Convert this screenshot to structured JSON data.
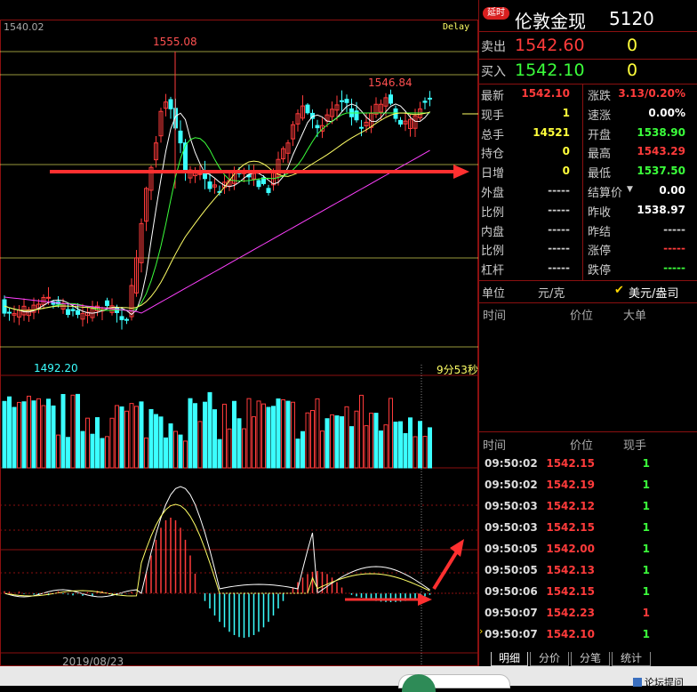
{
  "chart": {
    "price_top_left": "1540.02",
    "delay_label": "Delay",
    "high_label": "1555.08",
    "mid_high_label": "1546.84",
    "low_label": "1492.20",
    "countdown": "9分53秒",
    "date_label": "2019/08/23"
  },
  "header": {
    "badge": "延时",
    "title": "伦敦金现",
    "code": "5120"
  },
  "quote": {
    "sell_label": "卖出",
    "sell_price": "1542.60",
    "sell_qty": "0",
    "buy_label": "买入",
    "buy_price": "1542.10",
    "buy_qty": "0"
  },
  "stats": {
    "left": [
      {
        "label": "最新",
        "value": "1542.10",
        "color": "#ff3b3b"
      },
      {
        "label": "现手",
        "value": "1",
        "color": "#ffff3b"
      },
      {
        "label": "总手",
        "value": "14521",
        "color": "#ffff3b"
      },
      {
        "label": "持仓",
        "value": "0",
        "color": "#ffff3b"
      },
      {
        "label": "日增",
        "value": "0",
        "color": "#ffff3b"
      },
      {
        "label": "外盘",
        "value": "-----",
        "color": "#cccccc"
      },
      {
        "label": "比例",
        "value": "-----",
        "color": "#cccccc"
      },
      {
        "label": "内盘",
        "value": "-----",
        "color": "#cccccc"
      },
      {
        "label": "比例",
        "value": "-----",
        "color": "#cccccc"
      },
      {
        "label": "杠杆",
        "value": "-----",
        "color": "#cccccc"
      }
    ],
    "right": [
      {
        "label": "涨跌",
        "value": "3.13/0.20%",
        "color": "#ff3b3b"
      },
      {
        "label": "速涨",
        "value": "0.00%",
        "color": "#ffffff"
      },
      {
        "label": "开盘",
        "value": "1538.90",
        "color": "#3bff3b"
      },
      {
        "label": "最高",
        "value": "1543.29",
        "color": "#ff3b3b"
      },
      {
        "label": "最低",
        "value": "1537.50",
        "color": "#3bff3b"
      },
      {
        "label": "结算价",
        "value": "0.00",
        "color": "#ffffff"
      },
      {
        "label": "昨收",
        "value": "1538.97",
        "color": "#ffffff"
      },
      {
        "label": "昨结",
        "value": "-----",
        "color": "#cccccc"
      },
      {
        "label": "涨停",
        "value": "-----",
        "color": "#ff3b3b"
      },
      {
        "label": "跌停",
        "value": "-----",
        "color": "#3bff3b"
      }
    ]
  },
  "unit": {
    "label": "单位",
    "option_a": "元/克",
    "check": "✔",
    "option_b": "美元/盎司"
  },
  "bigorders": {
    "col_time": "时间",
    "col_price": "价位",
    "col_big": "大单"
  },
  "ticks": {
    "col_time": "时间",
    "col_price": "价位",
    "col_qty": "现手",
    "rows": [
      {
        "time": "09:50:02",
        "price": "1542.15",
        "qty": "1",
        "qty_color": "#3bff3b"
      },
      {
        "time": "09:50:02",
        "price": "1542.19",
        "qty": "1",
        "qty_color": "#3bff3b"
      },
      {
        "time": "09:50:03",
        "price": "1542.12",
        "qty": "1",
        "qty_color": "#3bff3b"
      },
      {
        "time": "09:50:03",
        "price": "1542.15",
        "qty": "1",
        "qty_color": "#3bff3b"
      },
      {
        "time": "09:50:05",
        "price": "1542.00",
        "qty": "1",
        "qty_color": "#3bff3b"
      },
      {
        "time": "09:50:05",
        "price": "1542.13",
        "qty": "1",
        "qty_color": "#3bff3b"
      },
      {
        "time": "09:50:06",
        "price": "1542.15",
        "qty": "1",
        "qty_color": "#3bff3b"
      },
      {
        "time": "09:50:07",
        "price": "1542.23",
        "qty": "1",
        "qty_color": "#ff3b3b"
      },
      {
        "time": "09:50:07",
        "price": "1542.10",
        "qty": "1",
        "qty_color": "#3bff3b"
      }
    ]
  },
  "tabs": [
    "明细",
    "分价",
    "分笔",
    "统计"
  ],
  "statusbar": {
    "forum_label": "论坛提问"
  },
  "colors": {
    "up": "#ff3b3b",
    "down": "#3bffff",
    "grid": "#8b1010",
    "ma_yellow": "#ffff66",
    "ma_magenta": "#ff40ff"
  }
}
